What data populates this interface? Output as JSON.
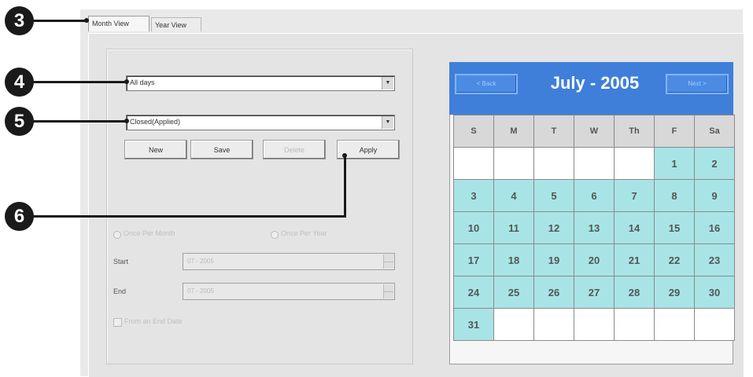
{
  "tabs": [
    {
      "label": "Month View",
      "active": true
    },
    {
      "label": "Year View",
      "active": false
    }
  ],
  "callouts": [
    "3",
    "4",
    "5",
    "6"
  ],
  "filters": {
    "days_combo": "All days",
    "schedule_combo": "Closed(Applied)"
  },
  "buttons": {
    "new": "New",
    "save": "Save",
    "delete": "Delete",
    "apply": "Apply"
  },
  "recurrence": {
    "once_per_month": "Once Per Month",
    "once_per_year": "Once Per Year",
    "start_label": "Start",
    "start_value": "07 - 2005",
    "end_label": "End",
    "end_value": "07 - 2005",
    "from_end_date": "From an End Date"
  },
  "calendar": {
    "back": "< Back",
    "next": "Next >",
    "title": "July - 2005",
    "weekdays": [
      "S",
      "M",
      "T",
      "W",
      "Th",
      "F",
      "Sa"
    ],
    "days": [
      "",
      "",
      "",
      "",
      "",
      "1",
      "2",
      "3",
      "4",
      "5",
      "6",
      "7",
      "8",
      "9",
      "10",
      "11",
      "12",
      "13",
      "14",
      "15",
      "16",
      "17",
      "18",
      "19",
      "20",
      "21",
      "22",
      "23",
      "24",
      "25",
      "26",
      "27",
      "28",
      "29",
      "30",
      "31",
      "",
      "",
      "",
      "",
      "",
      ""
    ],
    "highlight_color": "#a8e4e6",
    "header_color": "#3f7fd9"
  }
}
